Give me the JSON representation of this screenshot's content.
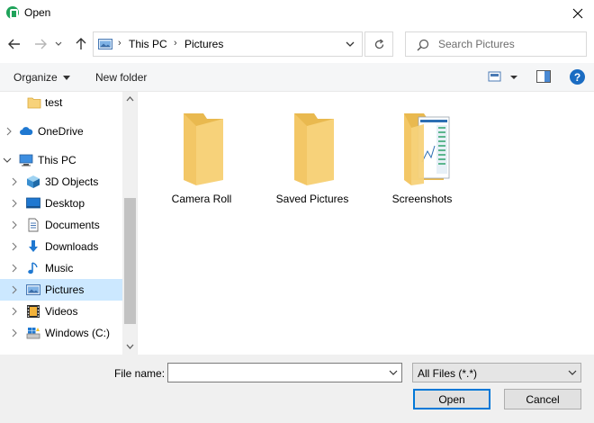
{
  "window": {
    "title": "Open"
  },
  "address": {
    "crumbs": [
      "This PC",
      "Pictures"
    ]
  },
  "search": {
    "placeholder": "Search Pictures"
  },
  "toolbar": {
    "organize_label": "Organize",
    "new_folder_label": "New folder",
    "help_label": "?"
  },
  "sidebar": {
    "items": [
      {
        "label": "test",
        "icon": "folder-icon",
        "chevron": false,
        "selected": false
      },
      {
        "label": "OneDrive",
        "icon": "cloud-icon",
        "chevron": "right",
        "selected": false
      },
      {
        "label": "This PC",
        "icon": "computer-icon",
        "chevron": "down",
        "selected": false
      },
      {
        "label": "3D Objects",
        "icon": "cube-icon",
        "chevron": "right",
        "selected": false
      },
      {
        "label": "Desktop",
        "icon": "desktop-icon",
        "chevron": "right",
        "selected": false
      },
      {
        "label": "Documents",
        "icon": "document-icon",
        "chevron": "right",
        "selected": false
      },
      {
        "label": "Downloads",
        "icon": "download-arrow-icon",
        "chevron": "right",
        "selected": false
      },
      {
        "label": "Music",
        "icon": "music-note-icon",
        "chevron": "right",
        "selected": false
      },
      {
        "label": "Pictures",
        "icon": "pictures-icon",
        "chevron": "right",
        "selected": true
      },
      {
        "label": "Videos",
        "icon": "film-icon",
        "chevron": "right",
        "selected": false
      },
      {
        "label": "Windows (C:)",
        "icon": "drive-icon",
        "chevron": "right",
        "selected": false
      }
    ]
  },
  "folders": [
    {
      "name": "Camera Roll",
      "icon": "folder-icon"
    },
    {
      "name": "Saved Pictures",
      "icon": "folder-icon"
    },
    {
      "name": "Screenshots",
      "icon": "folder-with-screenshots-icon"
    }
  ],
  "bottom": {
    "file_name_label": "File name:",
    "file_name_value": "",
    "file_type_value": "All Files (*.*)",
    "open_label": "Open",
    "cancel_label": "Cancel"
  },
  "colors": {
    "selection": "#cce8ff",
    "folder": "#f7d27a",
    "accent": "#0078d7"
  }
}
